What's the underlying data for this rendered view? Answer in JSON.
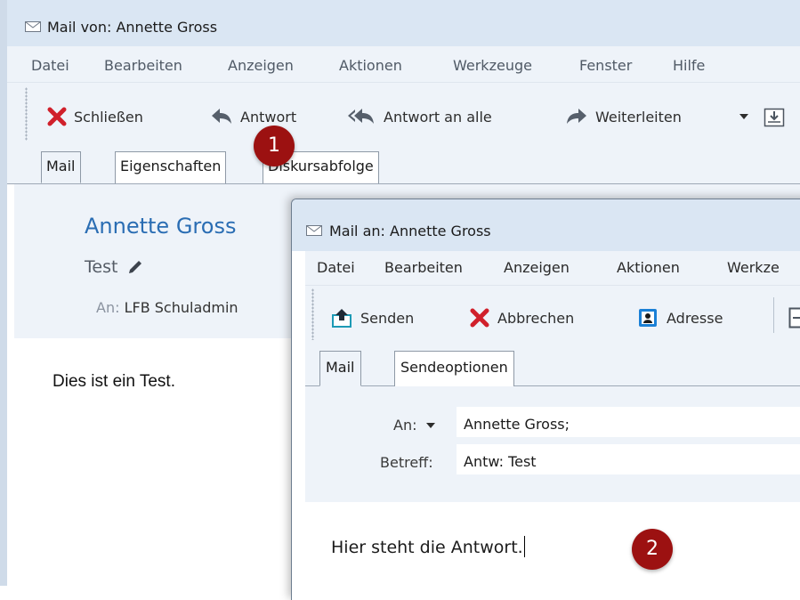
{
  "main_window": {
    "title": "Mail von: Annette Gross",
    "menu": [
      "Datei",
      "Bearbeiten",
      "Anzeigen",
      "Aktionen",
      "Werkzeuge",
      "Fenster",
      "Hilfe"
    ],
    "toolbar": {
      "close_label": "Schließen",
      "reply_label": "Antwort",
      "reply_all_label": "Antwort an alle",
      "forward_label": "Weiterleiten"
    },
    "tabs": [
      "Mail",
      "Eigenschaften",
      "Diskursabfolge"
    ],
    "header": {
      "sender": "Annette Gross",
      "subject": "Test",
      "to_label": "An:",
      "to_value": "LFB Schuladmin"
    },
    "body": "Dies ist ein Test."
  },
  "reply_window": {
    "title": "Mail an: Annette Gross",
    "menu": [
      "Datei",
      "Bearbeiten",
      "Anzeigen",
      "Aktionen",
      "Werkze"
    ],
    "toolbar": {
      "send_label": "Senden",
      "cancel_label": "Abbrechen",
      "address_label": "Adresse"
    },
    "tabs": [
      "Mail",
      "Sendeoptionen"
    ],
    "fields": {
      "to_label": "An:",
      "to_value": "Annette Gross;",
      "subject_label": "Betreff:",
      "subject_value": "Antw: Test"
    },
    "body": "Hier steht die Antwort."
  },
  "annotations": [
    "1",
    "2"
  ],
  "colors": {
    "accent_blue": "#2a6db3",
    "badge_red": "#9c1111",
    "close_red": "#d0202b",
    "chrome": "#eef3f9"
  },
  "icons": [
    "envelope-icon",
    "close-x-icon",
    "reply-arrow-icon",
    "reply-all-icon",
    "forward-arrow-icon",
    "dropdown-icon",
    "save-tray-icon",
    "pencil-icon",
    "send-icon",
    "address-book-icon"
  ]
}
